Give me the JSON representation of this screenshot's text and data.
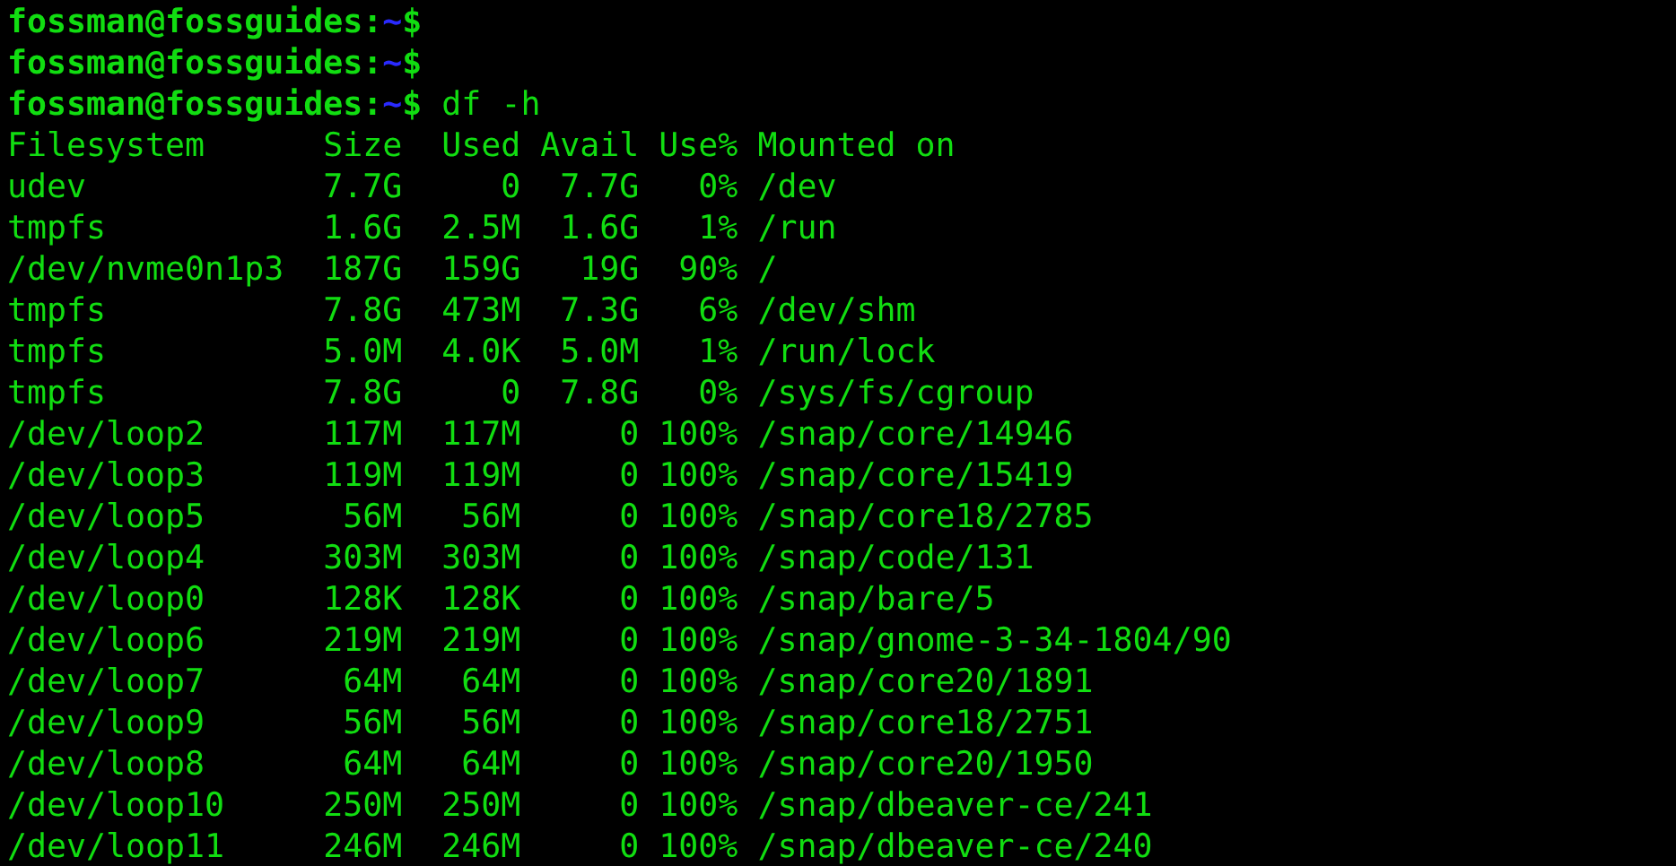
{
  "prompts": [
    {
      "user_host": "fossman@fossguides",
      "separator": ":",
      "path": "~",
      "symbol": "$"
    },
    {
      "user_host": "fossman@fossguides",
      "separator": ":",
      "path": "~",
      "symbol": "$"
    },
    {
      "user_host": "fossman@fossguides",
      "separator": ":",
      "path": "~",
      "symbol": "$",
      "command": "df -h"
    }
  ],
  "table": {
    "columns": [
      "Filesystem",
      "Size",
      "Used",
      "Avail",
      "Use%",
      "Mounted on"
    ],
    "rows": [
      [
        "udev",
        "7.7G",
        "0",
        "7.7G",
        "0%",
        "/dev"
      ],
      [
        "tmpfs",
        "1.6G",
        "2.5M",
        "1.6G",
        "1%",
        "/run"
      ],
      [
        "/dev/nvme0n1p3",
        "187G",
        "159G",
        "19G",
        "90%",
        "/"
      ],
      [
        "tmpfs",
        "7.8G",
        "473M",
        "7.3G",
        "6%",
        "/dev/shm"
      ],
      [
        "tmpfs",
        "5.0M",
        "4.0K",
        "5.0M",
        "1%",
        "/run/lock"
      ],
      [
        "tmpfs",
        "7.8G",
        "0",
        "7.8G",
        "0%",
        "/sys/fs/cgroup"
      ],
      [
        "/dev/loop2",
        "117M",
        "117M",
        "0",
        "100%",
        "/snap/core/14946"
      ],
      [
        "/dev/loop3",
        "119M",
        "119M",
        "0",
        "100%",
        "/snap/core/15419"
      ],
      [
        "/dev/loop5",
        "56M",
        "56M",
        "0",
        "100%",
        "/snap/core18/2785"
      ],
      [
        "/dev/loop4",
        "303M",
        "303M",
        "0",
        "100%",
        "/snap/code/131"
      ],
      [
        "/dev/loop0",
        "128K",
        "128K",
        "0",
        "100%",
        "/snap/bare/5"
      ],
      [
        "/dev/loop6",
        "219M",
        "219M",
        "0",
        "100%",
        "/snap/gnome-3-34-1804/90"
      ],
      [
        "/dev/loop7",
        "64M",
        "64M",
        "0",
        "100%",
        "/snap/core20/1891"
      ],
      [
        "/dev/loop9",
        "56M",
        "56M",
        "0",
        "100%",
        "/snap/core18/2751"
      ],
      [
        "/dev/loop8",
        "64M",
        "64M",
        "0",
        "100%",
        "/snap/core20/1950"
      ],
      [
        "/dev/loop10",
        "250M",
        "250M",
        "0",
        "100%",
        "/snap/dbeaver-ce/241"
      ],
      [
        "/dev/loop11",
        "246M",
        "246M",
        "0",
        "100%",
        "/snap/dbeaver-ce/240"
      ]
    ]
  }
}
